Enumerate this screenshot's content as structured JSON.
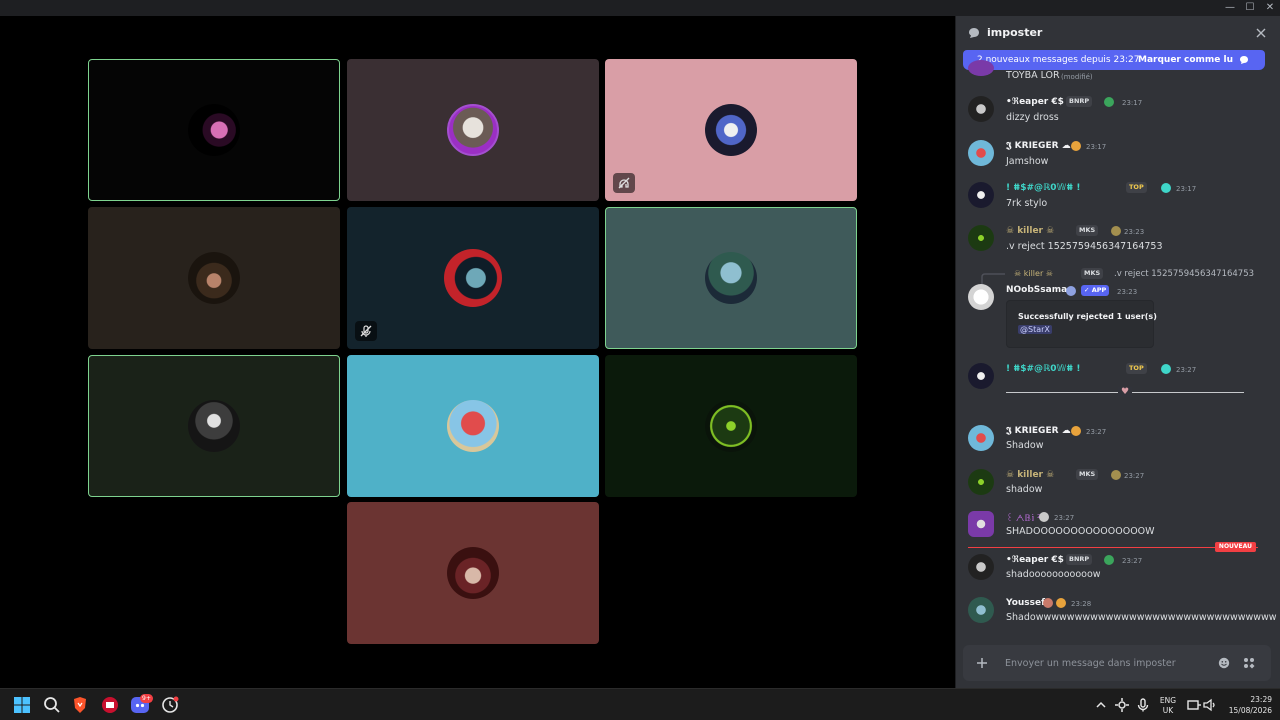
{
  "window": {
    "minimize": "—",
    "maximize": "☐",
    "close": "✕"
  },
  "chat": {
    "channel_name": "imposter",
    "banner_text": "2 nouveaux messages depuis 23:27",
    "banner_action": "Marquer comme lu",
    "partial_message": "TOYBA LOR",
    "partial_edited": "(modifié)",
    "composer_placeholder": "Envoyer un message dans imposter",
    "new_label": "NOUVEAU",
    "messages": [
      {
        "user": "•ℜeaper €$",
        "badge": "BNRP",
        "time": "23:17",
        "text": "dizzy dross"
      },
      {
        "user": "𝕵 KRIEGER ☁",
        "time": "23:17",
        "text": "Jamshow"
      },
      {
        "user": "! ⵌ$#@ℝ0𝕎ⵌ !",
        "badge": "TOP",
        "time": "23:17",
        "text": "7rk stylo"
      },
      {
        "user": "☠ killer ☠",
        "badge": "MKS",
        "time": "23:23",
        "text": ".v reject 1525759456347164753"
      },
      {
        "reply_user": "☠ killer ☠",
        "reply_badge": "MKS",
        "reply_text": ".v reject 1525759456347164753",
        "user": "NOobSsama",
        "badge": "✓ APP",
        "time": "23:23",
        "embed_title": "Successfully rejected 1 user(s)",
        "embed_mention": "@StarX"
      },
      {
        "user": "! ⵌ$#@ℝ0𝕎ⵌ !",
        "badge": "TOP",
        "time": "23:27"
      },
      {
        "user": "𝕵 KRIEGER ☁",
        "time": "23:27",
        "text": "Shadow"
      },
      {
        "user": "☠ killer ☠",
        "badge": "MKS",
        "time": "23:27",
        "text": "shadow"
      },
      {
        "user": "꒰ ᗅ𝔹𝕚 ²⁶",
        "time": "23:27",
        "text": "SHADOOOOOOOOOOOOOOOW"
      },
      {
        "user": "•ℜeaper €$",
        "badge": "BNRP",
        "time": "23:27",
        "text": "shadooooooooooow"
      },
      {
        "user": "Youssef",
        "time": "23:28",
        "text": "Shadowwwwwwwwwwwwwwwwwwwwwwwwwwwwwww"
      }
    ]
  },
  "taskbar": {
    "discord_badge": "9+",
    "language_top": "ENG",
    "language_bottom": "UK",
    "clock_time": "23:29",
    "clock_date": "15/08/2026"
  },
  "colors": {
    "accent": "#5865f2",
    "speaking_border": "#7ed38f",
    "unread_red": "#f23f43"
  },
  "icons": [
    "chat-bubble-icon",
    "close-icon",
    "mute-icon",
    "deafen-icon",
    "plus-icon",
    "emoji-icon",
    "apps-icon",
    "windows-start-icon",
    "search-icon",
    "brave-icon",
    "discord-icon",
    "clock-icon"
  ]
}
